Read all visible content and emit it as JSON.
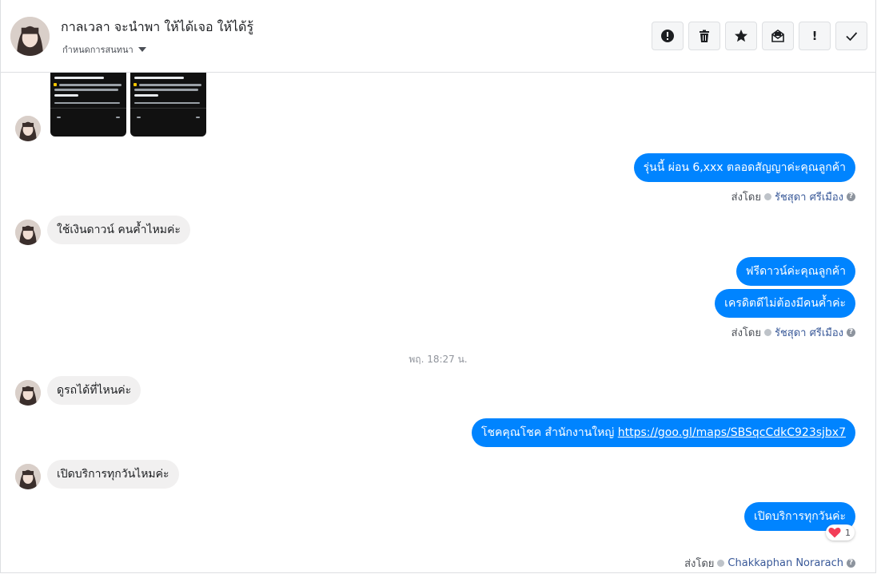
{
  "header": {
    "contact_name": "กาลเวลา จะนำพา ให้ได้เจอ ให้ได้รู้",
    "assign_label": "กำหนดการสนทนา",
    "toolbar": [
      {
        "name": "alert-circle-button",
        "icon": "alert-circle-icon"
      },
      {
        "name": "delete-button",
        "icon": "trash-icon"
      },
      {
        "name": "star-button",
        "icon": "star-icon"
      },
      {
        "name": "mark-unread-button",
        "icon": "envelope-open-icon"
      },
      {
        "name": "important-button",
        "icon": "exclamation-icon",
        "glyph": "!"
      },
      {
        "name": "done-button",
        "icon": "check-icon"
      }
    ]
  },
  "thread": {
    "attachments": [
      {
        "title": "Hilux Vigo Champ 2.5 J"
      },
      {
        "title": "Hilux Vigo Champ 2.5 J"
      }
    ],
    "msg_out_1": "รุ่นนี้ ผ่อน 6,xxx ตลอดสัญญาค่ะคุณลูกค้า",
    "sent_by_1": {
      "label": "ส่งโดย",
      "name": "รัชสุดา ศรีเมือง"
    },
    "msg_in_1": "ใช้เงินดาวน์ คนค้ำไหมค่ะ",
    "msg_out_2": "ฟรีดาวน์ค่ะคุณลูกค้า",
    "msg_out_3": "เครดิตดีไม่ต้องมีคนค้ำค่ะ",
    "sent_by_2": {
      "label": "ส่งโดย",
      "name": "รัชสุดา ศรีเมือง"
    },
    "timestamp": "พฤ. 18:27 น.",
    "msg_in_2": "ดูรถได้ที่ไหนค่ะ",
    "msg_out_4_text": "โชคคุณโชค สำนักงานใหญ่ ",
    "msg_out_4_link": "https://goo.gl/maps/SBSqcCdkC923sjbx7",
    "msg_in_3": "เปิดบริการทุกวันไหมค่ะ",
    "msg_out_5": "เปิดบริการทุกวันค่ะ",
    "reaction": {
      "icon": "heart-icon",
      "count": "1",
      "color": "#f33e58"
    },
    "sent_by_3": {
      "label": "ส่งโดย",
      "name": "Chakkaphan Norarach"
    }
  },
  "colors": {
    "outgoing": "#0084ff",
    "incoming": "#f1f0f0",
    "link_name": "#385898"
  }
}
